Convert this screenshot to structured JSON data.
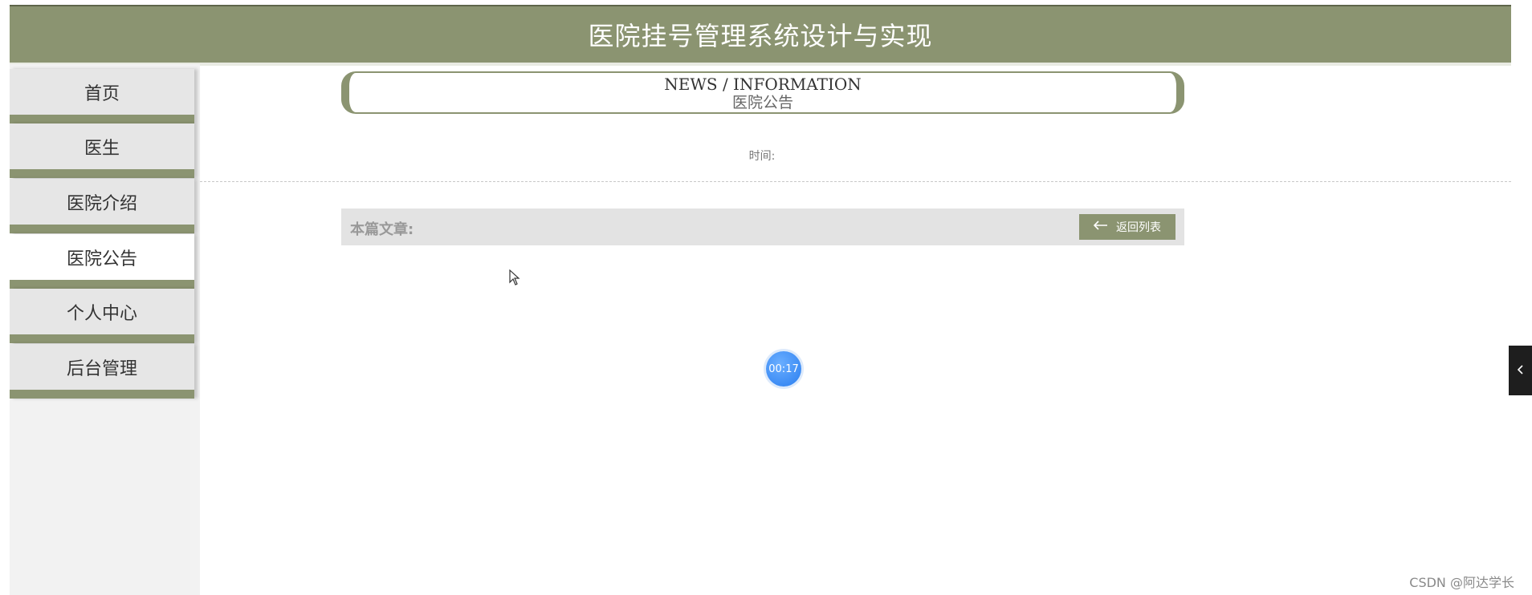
{
  "header": {
    "title": "医院挂号管理系统设计与实现"
  },
  "sidebar": {
    "items": [
      {
        "label": "首页",
        "active": false
      },
      {
        "label": "医生",
        "active": false
      },
      {
        "label": "医院介绍",
        "active": false
      },
      {
        "label": "医院公告",
        "active": true
      },
      {
        "label": "个人中心",
        "active": false
      },
      {
        "label": "后台管理",
        "active": false
      }
    ]
  },
  "main": {
    "news_en": "NEWS / INFORMATION",
    "news_cn": "医院公告",
    "time_label": "时间:",
    "article_label": "本篇文章:",
    "back_button": "返回列表"
  },
  "timer": "00:17",
  "watermark": "CSDN @阿达学长",
  "colors": {
    "accent": "#8b9471",
    "timer": "#2a7ef0"
  },
  "icons": {
    "back": "arrow-left-icon",
    "toggle": "chevron-left-icon",
    "cursor": "mouse-cursor-icon"
  }
}
